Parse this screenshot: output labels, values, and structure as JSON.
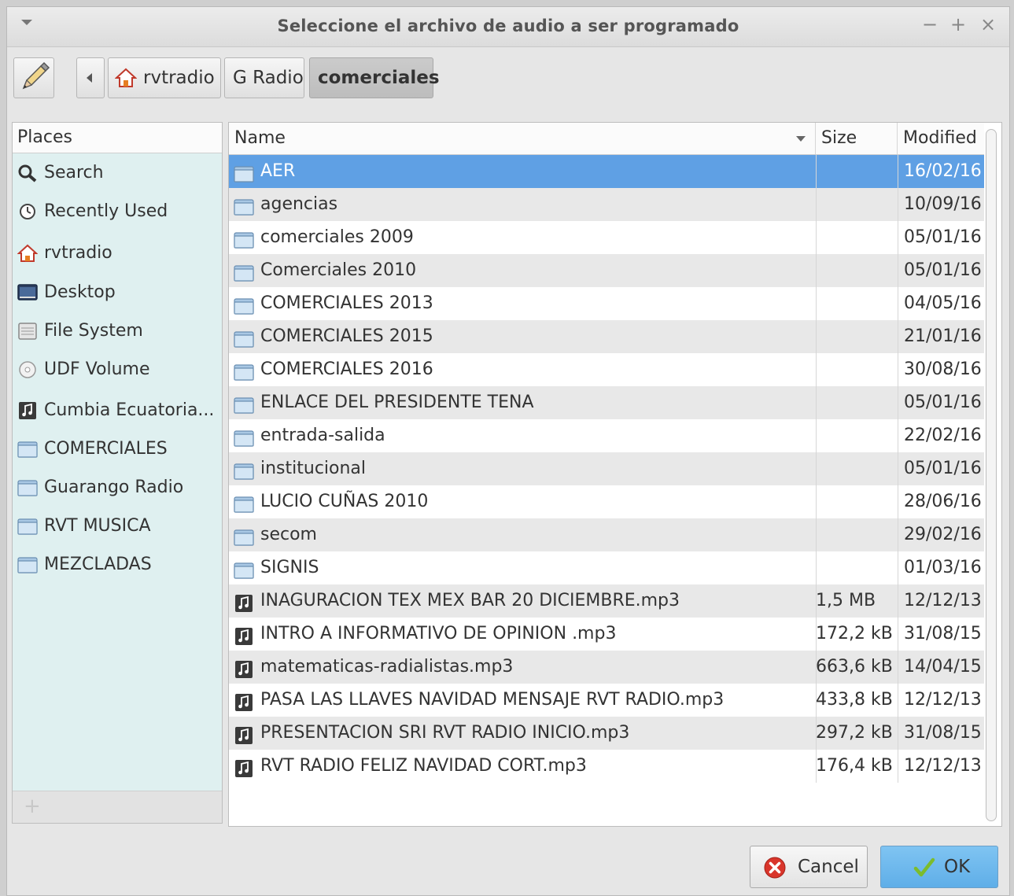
{
  "window": {
    "title": "Seleccione el archivo de audio a ser programado",
    "minimize": "−",
    "maximize": "+",
    "close": "×"
  },
  "breadcrumb": {
    "items": [
      {
        "label": "rvtradio",
        "icon": "home-icon"
      },
      {
        "label": "G Radio"
      },
      {
        "label": "comerciales",
        "active": true
      }
    ]
  },
  "places": {
    "header": "Places",
    "items": [
      {
        "label": "Search",
        "icon": "search-icon"
      },
      {
        "label": "Recently Used",
        "icon": "recent-icon"
      },
      {
        "label": "rvtradio",
        "icon": "home-icon"
      },
      {
        "label": "Desktop",
        "icon": "desktop-icon"
      },
      {
        "label": "File System",
        "icon": "drive-icon"
      },
      {
        "label": "UDF Volume",
        "icon": "disc-icon"
      },
      {
        "label": "Cumbia Ecuatoria...",
        "icon": "audio-file-icon"
      },
      {
        "label": "COMERCIALES",
        "icon": "folder-icon"
      },
      {
        "label": "Guarango Radio",
        "icon": "folder-icon"
      },
      {
        "label": "RVT MUSICA",
        "icon": "folder-icon"
      },
      {
        "label": "MEZCLADAS",
        "icon": "folder-icon"
      }
    ]
  },
  "files": {
    "columns": {
      "name": "Name",
      "size": "Size",
      "modified": "Modified"
    },
    "rows": [
      {
        "name": "AER",
        "size": "",
        "modified": "16/02/16",
        "type": "folder",
        "selected": true
      },
      {
        "name": "agencias",
        "size": "",
        "modified": "10/09/16",
        "type": "folder"
      },
      {
        "name": "comerciales 2009",
        "size": "",
        "modified": "05/01/16",
        "type": "folder"
      },
      {
        "name": "Comerciales 2010",
        "size": "",
        "modified": "05/01/16",
        "type": "folder"
      },
      {
        "name": "COMERCIALES 2013",
        "size": "",
        "modified": "04/05/16",
        "type": "folder"
      },
      {
        "name": "COMERCIALES 2015",
        "size": "",
        "modified": "21/01/16",
        "type": "folder"
      },
      {
        "name": "COMERCIALES 2016",
        "size": "",
        "modified": "30/08/16",
        "type": "folder"
      },
      {
        "name": "ENLACE DEL PRESIDENTE TENA",
        "size": "",
        "modified": "05/01/16",
        "type": "folder"
      },
      {
        "name": "entrada-salida",
        "size": "",
        "modified": "22/02/16",
        "type": "folder"
      },
      {
        "name": "institucional",
        "size": "",
        "modified": "05/01/16",
        "type": "folder"
      },
      {
        "name": "LUCIO CUÑAS 2010",
        "size": "",
        "modified": "28/06/16",
        "type": "folder"
      },
      {
        "name": "secom",
        "size": "",
        "modified": "29/02/16",
        "type": "folder"
      },
      {
        "name": "SIGNIS",
        "size": "",
        "modified": "01/03/16",
        "type": "folder"
      },
      {
        "name": "INAGURACION TEX MEX BAR 20 DICIEMBRE.mp3",
        "size": "1,5 MB",
        "modified": "12/12/13",
        "type": "audio"
      },
      {
        "name": "INTRO A INFORMATIVO DE OPINION .mp3",
        "size": "172,2 kB",
        "modified": "31/08/15",
        "type": "audio"
      },
      {
        "name": "matematicas-radialistas.mp3",
        "size": "663,6 kB",
        "modified": "14/04/15",
        "type": "audio"
      },
      {
        "name": "PASA LAS LLAVES NAVIDAD MENSAJE RVT RADIO.mp3",
        "size": "433,8 kB",
        "modified": "12/12/13",
        "type": "audio"
      },
      {
        "name": "PRESENTACION SRI RVT RADIO INICIO.mp3",
        "size": "297,2 kB",
        "modified": "31/08/15",
        "type": "audio"
      },
      {
        "name": "RVT RADIO FELIZ NAVIDAD CORT.mp3",
        "size": "176,4 kB",
        "modified": "12/12/13",
        "type": "audio"
      }
    ]
  },
  "buttons": {
    "cancel": "Cancel",
    "ok": "OK"
  },
  "colors": {
    "selection": "#5fa0e4",
    "places_bg": "#dff0f0",
    "ok_button": "#6cb8ee"
  }
}
